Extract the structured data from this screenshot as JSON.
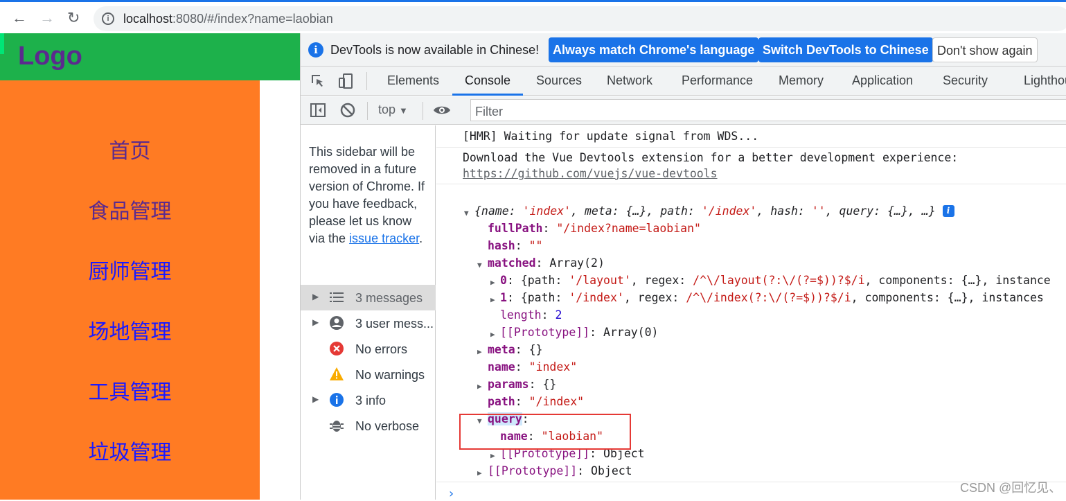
{
  "browser": {
    "url_host": "localhost",
    "url_rest": ":8080/#/index?name=laobian"
  },
  "page": {
    "logo": "Logo",
    "menu": [
      {
        "label": "首页",
        "color": "#5b2a8e"
      },
      {
        "label": "食品管理",
        "color": "#5b2a8e"
      },
      {
        "label": "厨师管理",
        "color": "#1a1aff"
      },
      {
        "label": "场地管理",
        "color": "#1a1aff"
      },
      {
        "label": "工具管理",
        "color": "#1a1aff"
      },
      {
        "label": "垃圾管理",
        "color": "#1a1aff"
      }
    ]
  },
  "devtools": {
    "banner": {
      "text": "DevTools is now available in Chinese!",
      "btn_match": "Always match Chrome's language",
      "btn_switch": "Switch DevTools to Chinese",
      "btn_dismiss": "Don't show again"
    },
    "tabs": [
      "Elements",
      "Console",
      "Sources",
      "Network",
      "Performance",
      "Memory",
      "Application",
      "Security",
      "Lighthou"
    ],
    "filter": {
      "context": "top",
      "placeholder": "Filter"
    },
    "sidebar": {
      "note": "This sidebar will be removed in a future version of Chrome. If you have feedback, please let us know via the",
      "note_link": "issue tracker",
      "note_end": ".",
      "items": [
        {
          "label": "3 messages",
          "icon": "list-icon"
        },
        {
          "label": "3 user mess...",
          "icon": "user-icon"
        },
        {
          "label": "No errors",
          "icon": "error-icon"
        },
        {
          "label": "No warnings",
          "icon": "warning-icon"
        },
        {
          "label": "3 info",
          "icon": "info-icon"
        },
        {
          "label": "No verbose",
          "icon": "bug-icon"
        }
      ]
    },
    "console": {
      "hmr": "[HMR] Waiting for update signal from WDS...",
      "vue_msg": "Download the Vue Devtools extension for a better development experience:",
      "vue_link": "https://github.com/vuejs/vue-devtools",
      "obj_summary_1": "{name: ",
      "obj_summary_name": "'index'",
      "obj_summary_2": ", meta: {…}, path: ",
      "obj_summary_path": "'/index'",
      "obj_summary_3": ", hash: ",
      "obj_summary_hash": "''",
      "obj_summary_4": ", query: {…}, …}",
      "fullPath_key": "fullPath",
      "fullPath_val": "\"/index?name=laobian\"",
      "hash_key": "hash",
      "hash_val": "\"\"",
      "matched_key": "matched",
      "matched_val": "Array(2)",
      "m0_key": "0",
      "m0_a": "{path: ",
      "m0_path": "'/layout'",
      "m0_b": ", regex: ",
      "m0_regex": "/^\\/layout(?:\\/(?=$))?$/i",
      "m0_c": ", components: {…}, instance",
      "m1_key": "1",
      "m1_a": "{path: ",
      "m1_path": "'/index'",
      "m1_b": ", regex: ",
      "m1_regex": "/^\\/index(?:\\/(?=$))?$/i",
      "m1_c": ", components: {…}, instances",
      "length_key": "length",
      "length_val": "2",
      "proto_key": "[[Prototype]]",
      "proto_array": "Array(0)",
      "meta_key": "meta",
      "meta_val": "{}",
      "name_key": "name",
      "name_val": "\"index\"",
      "params_key": "params",
      "params_val": "{}",
      "path_key": "path",
      "path_val": "\"/index\"",
      "query_key": "query",
      "qname_key": "name",
      "qname_val": "\"laobian\"",
      "proto_object": "Object"
    }
  },
  "watermark": "CSDN @回忆见、"
}
